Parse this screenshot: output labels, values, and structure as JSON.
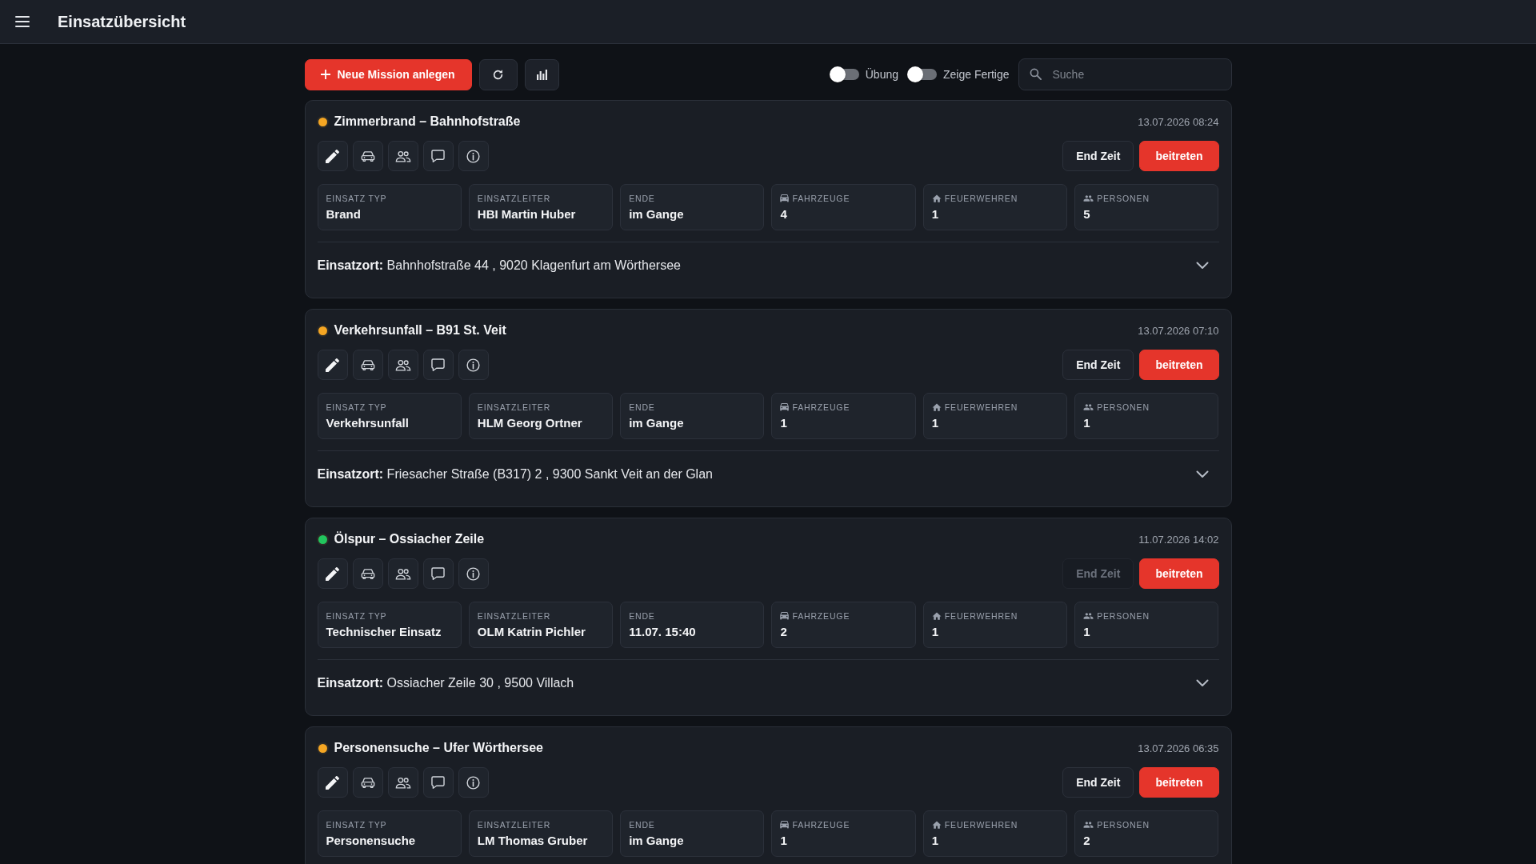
{
  "header": {
    "title": "Einsatzübersicht"
  },
  "toolbar": {
    "new_button": "Neue Mission anlegen",
    "toggles": [
      {
        "label": "Übung",
        "on": false
      },
      {
        "label": "Zeige Fertige",
        "on": false
      }
    ],
    "search": {
      "placeholder": "Suche"
    }
  },
  "cards": [
    {
      "color": "#f5a623",
      "title": "Zimmerbrand – Bahnhofstraße",
      "timestamp": "13.07.2026 08:24",
      "end_button": {
        "label": "End Zeit",
        "disabled": false
      },
      "join_button": "beitreten",
      "stats": [
        {
          "kind": "text",
          "label": "EINSATZ TYP",
          "value": "Brand"
        },
        {
          "kind": "text",
          "label": "EINSATZLEITER",
          "value": "HBI Martin Huber"
        },
        {
          "kind": "text",
          "label": "ENDE",
          "value": "im Gange"
        },
        {
          "kind": "car",
          "label": "FAHRZEUGE",
          "value": "4"
        },
        {
          "kind": "house",
          "label": "FEUERWEHREN",
          "value": "1"
        },
        {
          "kind": "people",
          "label": "PERSONEN",
          "value": "5"
        }
      ],
      "location": {
        "text": "**Einsatzort:** Bahnhofstraße 44 , 9020 Klagenfurt am Wörthersee",
        "expanded": false
      }
    },
    {
      "color": "#f5a623",
      "title": "Verkehrsunfall – B91 St. Veit",
      "timestamp": "13.07.2026 07:10",
      "end_button": {
        "label": "End Zeit",
        "disabled": false
      },
      "join_button": "beitreten",
      "stats": [
        {
          "kind": "text",
          "label": "EINSATZ TYP",
          "value": "Verkehrsunfall"
        },
        {
          "kind": "text",
          "label": "EINSATZLEITER",
          "value": "HLM Georg Ortner"
        },
        {
          "kind": "text",
          "label": "ENDE",
          "value": "im Gange"
        },
        {
          "kind": "car",
          "label": "FAHRZEUGE",
          "value": "1"
        },
        {
          "kind": "house",
          "label": "FEUERWEHREN",
          "value": "1"
        },
        {
          "kind": "people",
          "label": "PERSONEN",
          "value": "1"
        }
      ],
      "location": {
        "text": "**Einsatzort:** Friesacher Straße (B317) 2 , 9300 Sankt Veit an der Glan",
        "expanded": false
      }
    },
    {
      "color": "#22c55e",
      "title": "Ölspur – Ossiacher Zeile",
      "timestamp": "11.07.2026 14:02",
      "end_button": {
        "label": "End Zeit",
        "disabled": true
      },
      "join_button": "beitreten",
      "stats": [
        {
          "kind": "text",
          "label": "EINSATZ TYP",
          "value": "Technischer Einsatz"
        },
        {
          "kind": "text",
          "label": "EINSATZLEITER",
          "value": "OLM Katrin Pichler"
        },
        {
          "kind": "text",
          "label": "ENDE",
          "value": "11.07. 15:40"
        },
        {
          "kind": "car",
          "label": "FAHRZEUGE",
          "value": "2"
        },
        {
          "kind": "house",
          "label": "FEUERWEHREN",
          "value": "1"
        },
        {
          "kind": "people",
          "label": "PERSONEN",
          "value": "1"
        }
      ],
      "location": {
        "text": "**Einsatzort:** Ossiacher Zeile 30 , 9500 Villach",
        "expanded": false
      }
    },
    {
      "color": "#f5a623",
      "title": "Personensuche – Ufer Wörthersee",
      "timestamp": "13.07.2026 06:35",
      "end_button": {
        "label": "End Zeit",
        "disabled": false
      },
      "join_button": "beitreten",
      "stats": [
        {
          "kind": "text",
          "label": "EINSATZ TYP",
          "value": "Personensuche"
        },
        {
          "kind": "text",
          "label": "EINSATZLEITER",
          "value": "LM Thomas Gruber"
        },
        {
          "kind": "text",
          "label": "ENDE",
          "value": "im Gange"
        },
        {
          "kind": "car",
          "label": "FAHRZEUGE",
          "value": "1"
        },
        {
          "kind": "house",
          "label": "FEUERWEHREN",
          "value": "1"
        },
        {
          "kind": "people",
          "label": "PERSONEN",
          "value": "2"
        }
      ]
    }
  ]
}
